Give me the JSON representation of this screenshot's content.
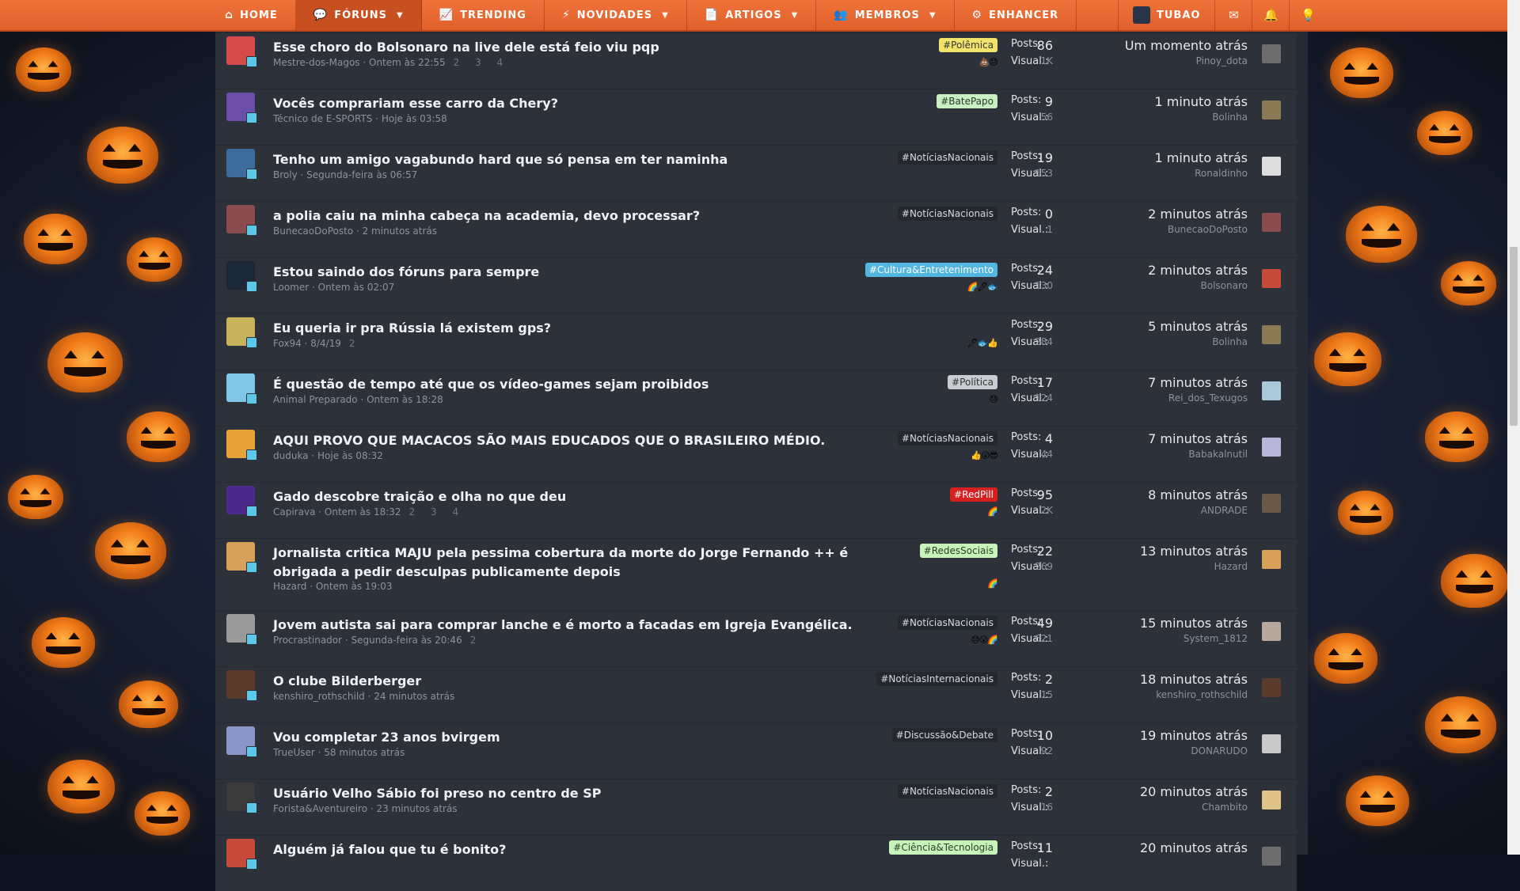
{
  "nav": {
    "items": [
      {
        "label": "HOME",
        "icon": "home-icon",
        "glyph": "⌂"
      },
      {
        "label": "FÓRUNS",
        "icon": "chat-icon",
        "glyph": "💬"
      },
      {
        "label": "TRENDING",
        "icon": "trending-icon",
        "glyph": "📈"
      },
      {
        "label": "NOVIDADES",
        "icon": "bolt-icon",
        "glyph": "⚡"
      },
      {
        "label": "ARTIGOS",
        "icon": "document-icon",
        "glyph": "📄"
      },
      {
        "label": "MEMBROS",
        "icon": "users-icon",
        "glyph": "👥"
      },
      {
        "label": "ENHANCER",
        "icon": "gears-icon",
        "glyph": "⚙"
      }
    ],
    "user": "TUBAO",
    "icons": [
      "mail-icon",
      "bell-icon",
      "bulb-icon"
    ]
  },
  "labels": {
    "posts": "Posts:",
    "views": "Visual.:"
  },
  "threads": [
    {
      "title": "Esse choro do Bolsonaro na live dele está feio viu pqp",
      "author": "Mestre-dos-Magos",
      "date": "Ontem às 22:55",
      "pages": "2 3 4",
      "tag": "#Polêmica",
      "tag_color": "yellow",
      "reactions": "💩😓",
      "posts": "86",
      "views": "1K",
      "last_time": "Um momento atrás",
      "last_user": "Pinoy_dota",
      "avatar_color": "#d64a4a",
      "last_color": "#6d6d6d"
    },
    {
      "title": "Vocês comprariam esse carro da Chery?",
      "author": "Técnico de E-SPORTS",
      "date": "Hoje às 03:58",
      "pages": "",
      "tag": "#BatePapo",
      "tag_color": "green",
      "reactions": "",
      "posts": "9",
      "views": "56",
      "last_time": "1 minuto atrás",
      "last_user": "Bolinha",
      "avatar_color": "#6b4fa8",
      "last_color": "#8a7a56"
    },
    {
      "title": "Tenho um amigo vagabundo hard que só pensa em ter naminha",
      "author": "Broly",
      "date": "Segunda-feira às 06:57",
      "pages": "",
      "tag": "#NotíciasNacionais",
      "tag_color": "dark",
      "reactions": "",
      "posts": "19",
      "views": "153",
      "last_time": "1 minuto atrás",
      "last_user": "Ronaldinho",
      "avatar_color": "#3d6b9e",
      "last_color": "#dddddd"
    },
    {
      "title": "a polia caiu na minha cabeça na academia, devo processar?",
      "author": "BunecaoDoPosto",
      "date": "2 minutos atrás",
      "pages": "",
      "tag": "#NotíciasNacionais",
      "tag_color": "dark",
      "reactions": "",
      "posts": "0",
      "views": "1",
      "last_time": "2 minutos atrás",
      "last_user": "BunecaoDoPosto",
      "avatar_color": "#8a4c4c",
      "last_color": "#8a4c4c"
    },
    {
      "title": "Estou saindo dos fóruns para sempre",
      "author": "Loomer",
      "date": "Ontem às 02:07",
      "pages": "",
      "tag": "#Cultura&Entretenimento",
      "tag_color": "blue",
      "reactions": "🌈🖊🐟",
      "posts": "24",
      "views": "130",
      "last_time": "2 minutos atrás",
      "last_user": "Bolsonaro",
      "avatar_color": "#1c2738",
      "last_color": "#c84a3a"
    },
    {
      "title": "Eu queria ir pra Rússia lá existem gps?",
      "author": "Fox94",
      "date": "8/4/19",
      "pages": "2",
      "tag": "",
      "tag_color": "",
      "reactions": "🖊🐟👍",
      "posts": "29",
      "views": "284",
      "last_time": "5 minutos atrás",
      "last_user": "Bolinha",
      "avatar_color": "#c9b35a",
      "last_color": "#8a7a56"
    },
    {
      "title": "É questão de tempo até que os vídeo-games sejam proibidos",
      "author": "Animal Preparado",
      "date": "Ontem às 18:28",
      "pages": "",
      "tag": "#Política",
      "tag_color": "gray",
      "reactions": "😓",
      "posts": "17",
      "views": "124",
      "last_time": "7 minutos atrás",
      "last_user": "Rei_dos_Texugos",
      "avatar_color": "#7fc6e6",
      "last_color": "#a9c9d9"
    },
    {
      "title": "AQUI PROVO QUE MACACOS SÃO MAIS EDUCADOS QUE O BRASILEIRO MÉDIO.",
      "author": "duduka",
      "date": "Hoje às 08:32",
      "pages": "",
      "tag": "#NotíciasNacionais",
      "tag_color": "dark",
      "reactions": "👍😲😎",
      "posts": "4",
      "views": "44",
      "last_time": "7 minutos atrás",
      "last_user": "Babakalnutil",
      "avatar_color": "#e8a43a",
      "last_color": "#b9b6d9"
    },
    {
      "title": "Gado descobre traição e olha no que deu",
      "author": "Capirava",
      "date": "Ontem às 18:32",
      "pages": "2 3 4",
      "tag": "#RedPill",
      "tag_color": "red",
      "reactions": "🌈",
      "posts": "95",
      "views": "2K",
      "last_time": "8 minutos atrás",
      "last_user": "ANDRADE",
      "avatar_color": "#4a2a8a",
      "last_color": "#6a5a4a"
    },
    {
      "title": "Jornalista critica MAJU pela pessima cobertura da morte do Jorge Fernando ++ é obrigada a pedir desculpas publicamente depois",
      "author": "Hazard",
      "date": "Ontem às 19:03",
      "pages": "",
      "tag": "#RedesSociais",
      "tag_color": "lgreen",
      "reactions": "🌈",
      "posts": "22",
      "views": "269",
      "last_time": "13 minutos atrás",
      "last_user": "Hazard",
      "avatar_color": "#d9a05a",
      "last_color": "#d9a05a"
    },
    {
      "title": "Jovem autista sai para comprar lanche e é morto a facadas em Igreja Evangélica.",
      "author": "Procrastinador",
      "date": "Segunda-feira às 20:46",
      "pages": "2",
      "tag": "#NotíciasNacionais",
      "tag_color": "dark",
      "reactions": "😓😲🌈",
      "posts": "49",
      "views": "621",
      "last_time": "15 minutos atrás",
      "last_user": "System_1812",
      "avatar_color": "#9a9a9a",
      "last_color": "#b8a9a0"
    },
    {
      "title": "O clube Bilderberger",
      "author": "kenshiro_rothschild",
      "date": "24 minutos atrás",
      "pages": "",
      "tag": "#NotíciasInternacionais",
      "tag_color": "dark",
      "reactions": "",
      "posts": "2",
      "views": "15",
      "last_time": "18 minutos atrás",
      "last_user": "kenshiro_rothschild",
      "avatar_color": "#5a3a2a",
      "last_color": "#5a3a2a"
    },
    {
      "title": "Vou completar 23 anos bvirgem",
      "author": "TrueUser",
      "date": "58 minutos atrás",
      "pages": "",
      "tag": "#Discussão&Debate",
      "tag_color": "dark",
      "reactions": "",
      "posts": "10",
      "views": "92",
      "last_time": "19 minutos atrás",
      "last_user": "DONARUDO",
      "avatar_color": "#8a96c8",
      "last_color": "#c9c9c9"
    },
    {
      "title": "Usuário Velho Sábio foi preso no centro de SP",
      "author": "Forista&Aventureiro",
      "date": "23 minutos atrás",
      "pages": "",
      "tag": "#NotíciasNacionais",
      "tag_color": "dark",
      "reactions": "",
      "posts": "2",
      "views": "16",
      "last_time": "20 minutos atrás",
      "last_user": "Chambito",
      "avatar_color": "#3a3a3a",
      "last_color": "#e0c48a"
    },
    {
      "title": "Alguém já falou que tu é bonito?",
      "author": "",
      "date": "",
      "pages": "",
      "tag": "#Ciência&Tecnologia",
      "tag_color": "lgreen",
      "reactions": "",
      "posts": "11",
      "views": "",
      "last_time": "20 minutos atrás",
      "last_user": "",
      "avatar_color": "#c84a3a",
      "last_color": "#6d6d6d"
    }
  ]
}
